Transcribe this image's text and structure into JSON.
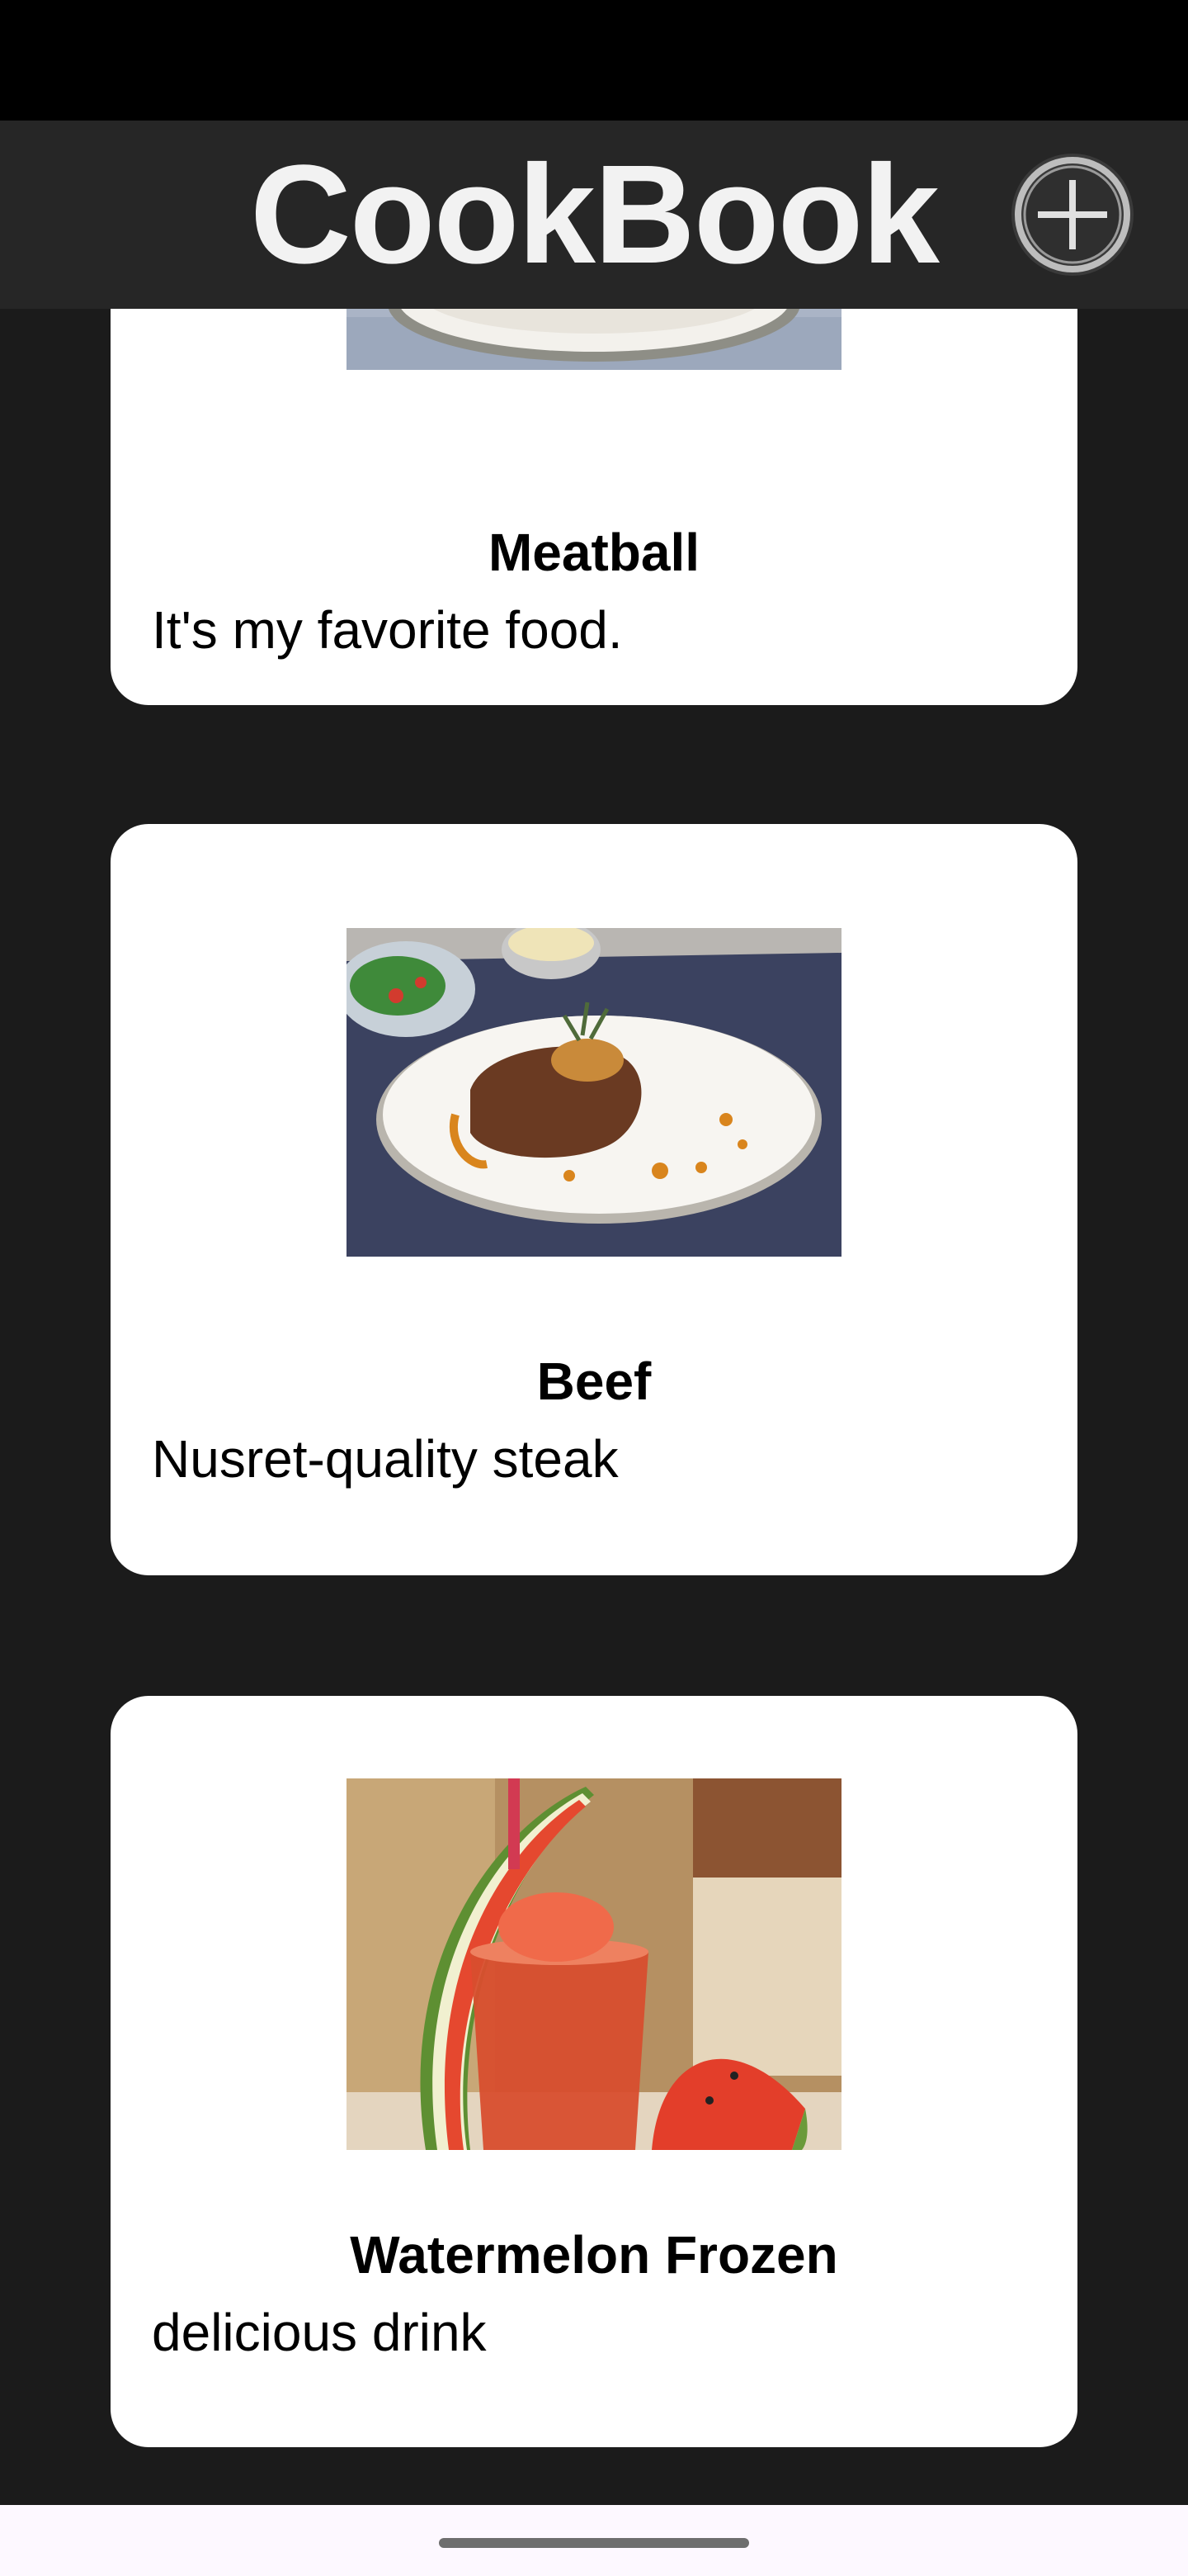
{
  "app": {
    "title": "CookBook",
    "add_icon": "plus-circle-icon"
  },
  "recipes": [
    {
      "name": "Meatball",
      "description": "It's my favorite food.",
      "photo": "meatball-photo"
    },
    {
      "name": "Beef",
      "description": "Nusret-quality steak",
      "photo": "steak-plate-photo"
    },
    {
      "name": "Watermelon Frozen",
      "description": "delicious drink",
      "photo": "watermelon-drink-photo"
    }
  ],
  "colors": {
    "background": "#1b1b1b",
    "app_bar": "#262626",
    "card": "#ffffff",
    "title": "#f2f2f2"
  }
}
